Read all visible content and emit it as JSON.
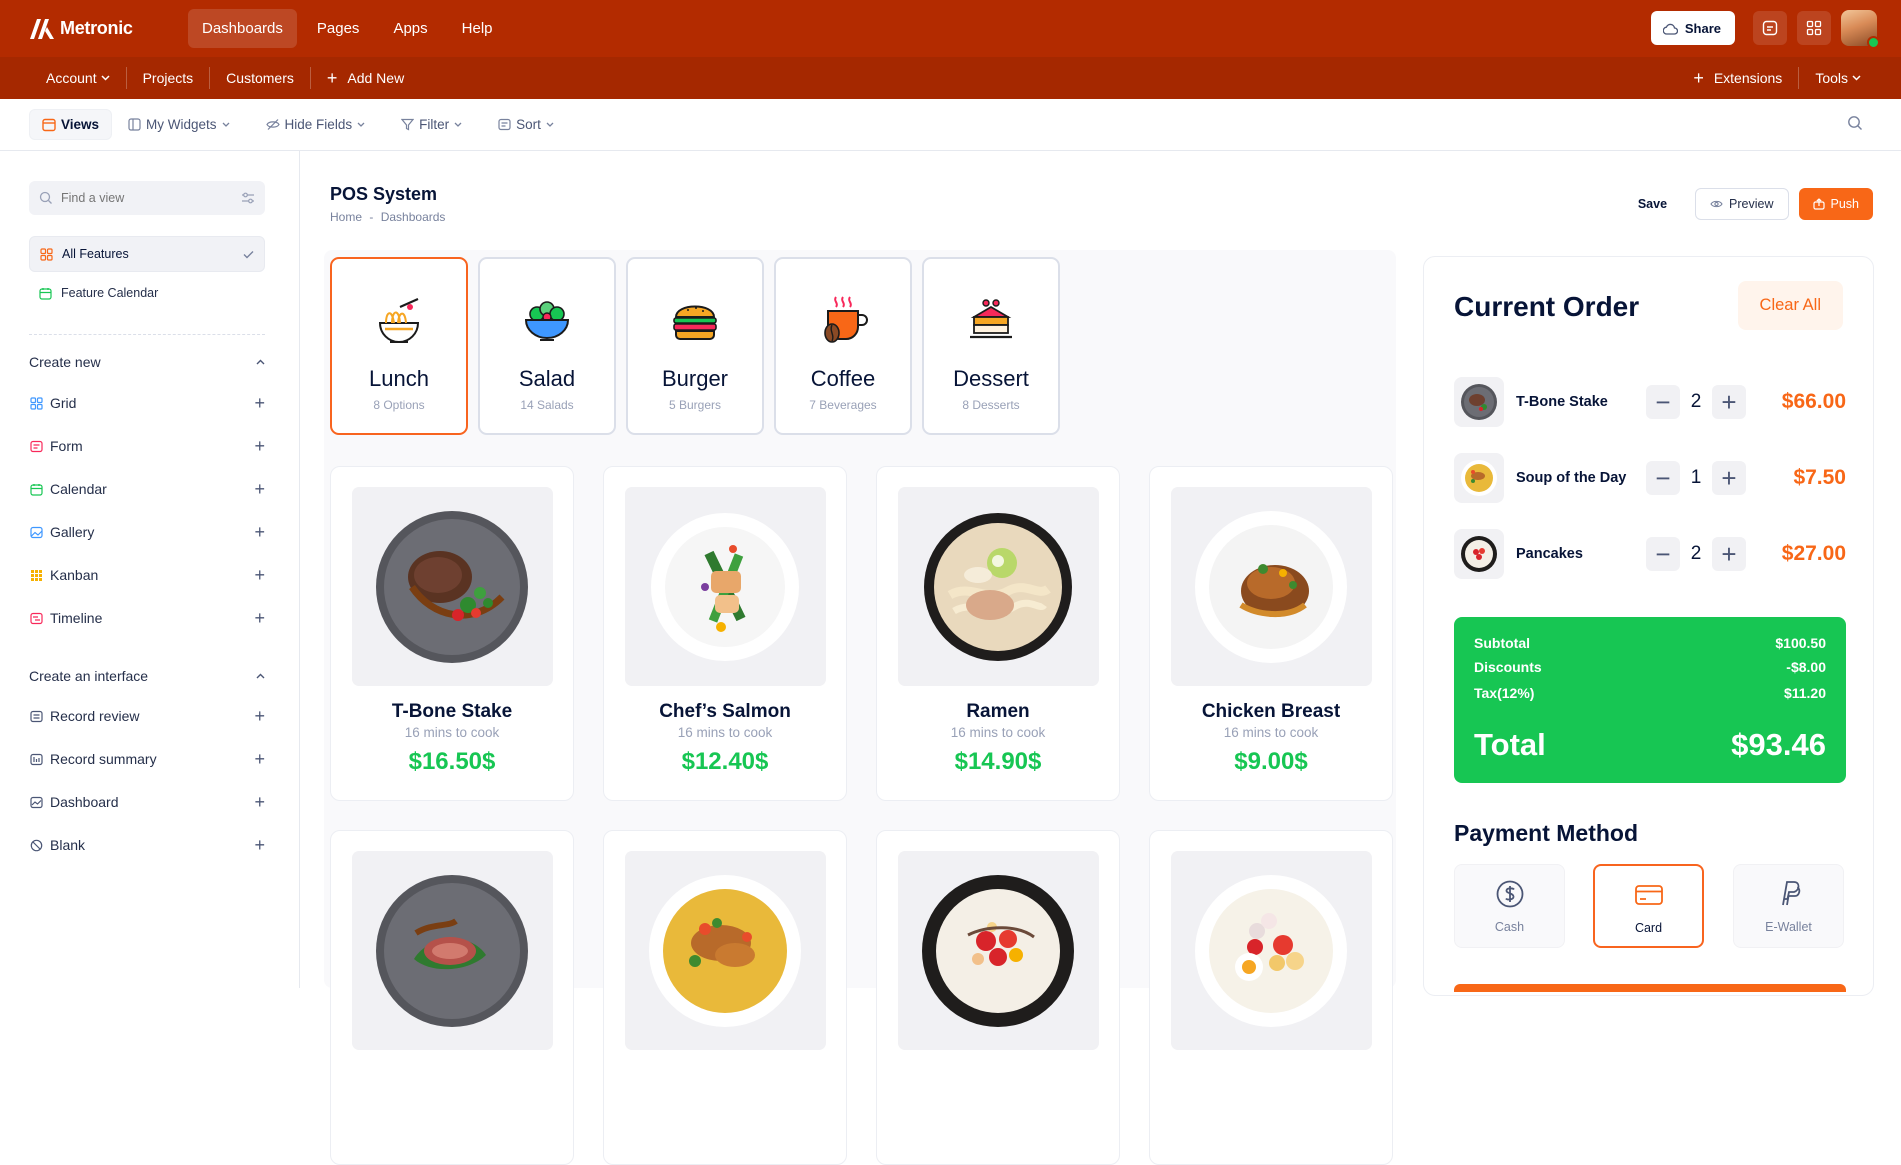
{
  "app": {
    "name": "Metronic"
  },
  "topnav": [
    "Dashboards",
    "Pages",
    "Apps",
    "Help"
  ],
  "share_label": "Share",
  "subnav": {
    "account": "Account",
    "projects": "Projects",
    "customers": "Customers",
    "add_new": "Add New",
    "extensions": "Extensions",
    "tools": "Tools"
  },
  "toolbar": {
    "views": "Views",
    "my_widgets": "My Widgets",
    "hide_fields": "Hide Fields",
    "filter": "Filter",
    "sort": "Sort"
  },
  "sidebar": {
    "search_placeholder": "Find a view",
    "all_features": "All Features",
    "feature_calendar": "Feature Calendar",
    "create_new": "Create new",
    "create_items": [
      "Grid",
      "Form",
      "Calendar",
      "Gallery",
      "Kanban",
      "Timeline"
    ],
    "create_interface": "Create an interface",
    "interface_items": [
      "Record review",
      "Record summary",
      "Dashboard",
      "Blank"
    ]
  },
  "page": {
    "title": "POS System",
    "breadcrumb_home": "Home",
    "breadcrumb_sep": "-",
    "breadcrumb_current": "Dashboards",
    "save": "Save",
    "preview": "Preview",
    "push": "Push"
  },
  "categories": [
    {
      "name": "Lunch",
      "count": "8 Options"
    },
    {
      "name": "Salad",
      "count": "14 Salads"
    },
    {
      "name": "Burger",
      "count": "5 Burgers"
    },
    {
      "name": "Coffee",
      "count": "7 Beverages"
    },
    {
      "name": "Dessert",
      "count": "8 Desserts"
    }
  ],
  "foods": [
    {
      "name": "T-Bone Stake",
      "time": "16 mins to cook",
      "price": "$16.50$"
    },
    {
      "name": "Chef’s Salmon",
      "time": "16 mins to cook",
      "price": "$12.40$"
    },
    {
      "name": "Ramen",
      "time": "16 mins to cook",
      "price": "$14.90$"
    },
    {
      "name": "Chicken Breast",
      "time": "16 mins to cook",
      "price": "$9.00$"
    }
  ],
  "order": {
    "title": "Current Order",
    "clear_all": "Clear All",
    "items": [
      {
        "name": "T-Bone Stake",
        "qty": "2",
        "price": "$66.00"
      },
      {
        "name": "Soup of the Day",
        "qty": "1",
        "price": "$7.50"
      },
      {
        "name": "Pancakes",
        "qty": "2",
        "price": "$27.00"
      }
    ],
    "subtotal_label": "Subtotal",
    "subtotal": "$100.50",
    "discounts_label": "Discounts",
    "discounts": "-$8.00",
    "tax_label": "Tax(12%)",
    "tax": "$11.20",
    "total_label": "Total",
    "total": "$93.46"
  },
  "payment": {
    "title": "Payment Method",
    "methods": [
      "Cash",
      "Card",
      "E-Wallet"
    ],
    "selected": "Card"
  },
  "colors": {
    "header_bg": "#b32b00",
    "subbar_bg": "#a52800",
    "accent_orange": "#f86717",
    "success_green": "#17c653",
    "text_dark": "#071437"
  },
  "icons": [
    "search-icon",
    "filter-settings-icon",
    "check-icon",
    "chevron-down-icon",
    "plus-icon",
    "eye-icon",
    "upload-icon",
    "dollar-icon",
    "card-icon",
    "paypal-icon"
  ]
}
